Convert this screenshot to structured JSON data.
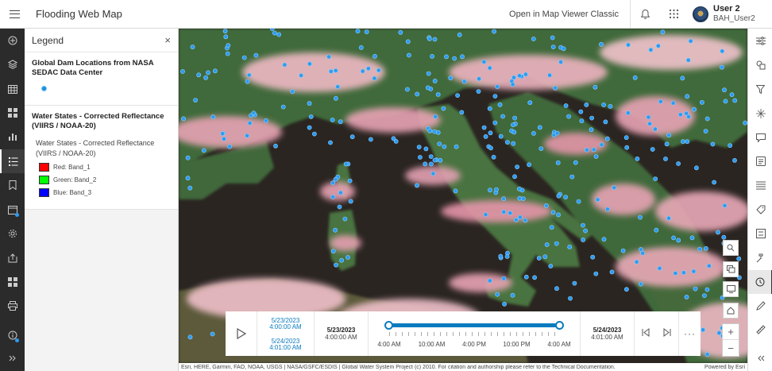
{
  "header": {
    "title": "Flooding Web Map",
    "open_classic": "Open in Map Viewer Classic",
    "user_name": "User 2",
    "user_id": "BAH_User2"
  },
  "legend": {
    "title": "Legend",
    "close": "×",
    "layers": [
      {
        "title": "Global Dam Locations from NASA SEDAC Data Center",
        "symbol_color": "#1e8fd8"
      },
      {
        "title": "Water States - Corrected Reflectance (VIIRS / NOAA-20)",
        "subtitle": "Water States - Corrected Reflectance (VIIRS / NOAA-20)",
        "bands": [
          {
            "label": "Red: Band_1",
            "color": "#ff0000"
          },
          {
            "label": "Green: Band_2",
            "color": "#00ff00"
          },
          {
            "label": "Blue: Band_3",
            "color": "#0000ff"
          }
        ]
      }
    ]
  },
  "time_slider": {
    "range_start_date": "5/23/2023",
    "range_start_time": "4:00:00 AM",
    "range_end_date": "5/24/2023",
    "range_end_time": "4:01:00 AM",
    "start_date": "5/23/2023",
    "start_time": "4:00:00 AM",
    "end_date": "5/24/2023",
    "end_time": "4:01:00 AM",
    "tick_labels": [
      "4:00 AM",
      "10:00 AM",
      "4:00 PM",
      "10:00 PM",
      "4:00 AM"
    ],
    "more": "···"
  },
  "attribution": {
    "text": "Esri, HERE, Garmin, FAO, NOAA, USGS | NASA/GSFC/ESDIS | Global Water System Project (c) 2010. For citation and authorship please refer to the Technical Documentation.",
    "powered": "Powered by Esri"
  },
  "colors": {
    "accent": "#0a7bbf",
    "dam_point": "#2d9bf0",
    "sea": "#2a2521",
    "land": "#3f6b3a",
    "cloud": "#e8a3b4"
  }
}
